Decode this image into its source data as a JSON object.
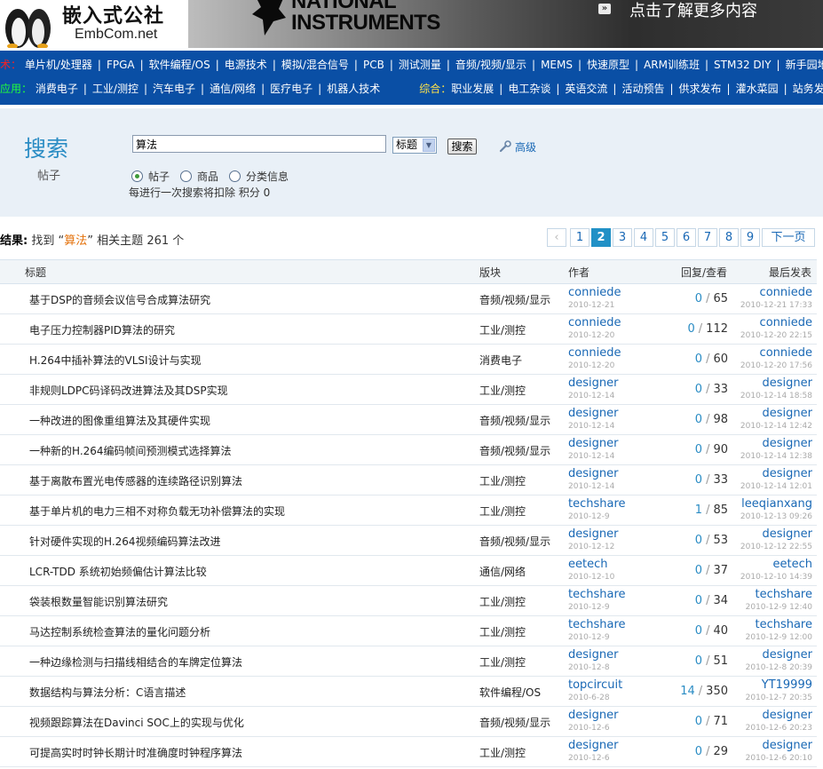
{
  "banner": {
    "logo_cn": "嵌入式公社",
    "logo_en": "EmbCom.net",
    "ad_line1": "NATIONAL",
    "ad_line2": "INSTRUMENTS",
    "ad_arrow": "»",
    "ad_text": "点击了解更多内容"
  },
  "nav": {
    "row1_label": "术：",
    "row1_items": [
      "单片机/处理器",
      "FPGA",
      "软件编程/OS",
      "电源技术",
      "模拟/混合信号",
      "PCB",
      "测试测量",
      "音频/视频/显示",
      "MEMS",
      "快速原型",
      "ARM训练班",
      "STM32 DIY",
      "新手园地"
    ],
    "row2_label": "应用：",
    "row2_items": [
      "消费电子",
      "工业/测控",
      "汽车电子",
      "通信/网络",
      "医疗电子",
      "机器人技术"
    ],
    "row2_label2": "综合：",
    "row2_items2": [
      "职业发展",
      "电工杂谈",
      "英语交流",
      "活动预告",
      "供求发布",
      "灌水菜园",
      "站务发展"
    ]
  },
  "search": {
    "title": "搜索",
    "subtitle": "帖子",
    "query": "算法",
    "scope": "标题",
    "button": "搜索",
    "advanced": "高级",
    "radios": [
      "帖子",
      "商品",
      "分类信息"
    ],
    "selected_radio": 0,
    "notice": "每进行一次搜索将扣除 积分 0"
  },
  "results": {
    "label": "结果:",
    "found": "找到",
    "keyword_open": "“",
    "keyword": "算法",
    "keyword_close": "”",
    "related": "相关主题",
    "count": "261",
    "unit": "个"
  },
  "pager": {
    "prev": "‹",
    "pages": [
      "1",
      "2",
      "3",
      "4",
      "5",
      "6",
      "7",
      "8",
      "9"
    ],
    "current": "2",
    "next": "下一页"
  },
  "table": {
    "headers": {
      "title": "标题",
      "forum": "版块",
      "author": "作者",
      "stats": "回复/查看",
      "last": "最后发表"
    },
    "rows": [
      {
        "title": "基于DSP的音频会议信号合成算法研究",
        "forum": "音频/视频/显示",
        "author": "conniede",
        "adate": "2010-12-21",
        "replies": "0",
        "views": "65",
        "last": "conniede",
        "ldate": "2010-12-21 17:33"
      },
      {
        "title": "电子压力控制器PID算法的研究",
        "forum": "工业/测控",
        "author": "conniede",
        "adate": "2010-12-20",
        "replies": "0",
        "views": "112",
        "last": "conniede",
        "ldate": "2010-12-20 22:15"
      },
      {
        "title": "H.264中插补算法的VLSI设计与实现",
        "forum": "消费电子",
        "author": "conniede",
        "adate": "2010-12-20",
        "replies": "0",
        "views": "60",
        "last": "conniede",
        "ldate": "2010-12-20 17:56"
      },
      {
        "title": "非规则LDPC码译码改进算法及其DSP实现",
        "forum": "工业/测控",
        "author": "designer",
        "adate": "2010-12-14",
        "replies": "0",
        "views": "33",
        "last": "designer",
        "ldate": "2010-12-14 18:58"
      },
      {
        "title": "一种改进的图像重组算法及其硬件实现",
        "forum": "音频/视频/显示",
        "author": "designer",
        "adate": "2010-12-14",
        "replies": "0",
        "views": "98",
        "last": "designer",
        "ldate": "2010-12-14 12:42"
      },
      {
        "title": "一种新的H.264编码帧间预测模式选择算法",
        "forum": "音频/视频/显示",
        "author": "designer",
        "adate": "2010-12-14",
        "replies": "0",
        "views": "90",
        "last": "designer",
        "ldate": "2010-12-14 12:38"
      },
      {
        "title": "基于离散布置光电传感器的连续路径识别算法",
        "forum": "工业/测控",
        "author": "designer",
        "adate": "2010-12-14",
        "replies": "0",
        "views": "33",
        "last": "designer",
        "ldate": "2010-12-14 12:01"
      },
      {
        "title": "基于单片机的电力三相不对称负载无功补偿算法的实现",
        "forum": "工业/测控",
        "author": "techshare",
        "adate": "2010-12-9",
        "replies": "1",
        "views": "85",
        "last": "leeqianxang",
        "ldate": "2010-12-13 09:26"
      },
      {
        "title": "针对硬件实现的H.264视频编码算法改进",
        "forum": "音频/视频/显示",
        "author": "designer",
        "adate": "2010-12-12",
        "replies": "0",
        "views": "53",
        "last": "designer",
        "ldate": "2010-12-12 22:55"
      },
      {
        "title": "LCR-TDD 系统初始频偏估计算法比较",
        "forum": "通信/网络",
        "author": "eetech",
        "adate": "2010-12-10",
        "replies": "0",
        "views": "37",
        "last": "eetech",
        "ldate": "2010-12-10 14:39"
      },
      {
        "title": "袋装根数量智能识别算法研究",
        "forum": "工业/测控",
        "author": "techshare",
        "adate": "2010-12-9",
        "replies": "0",
        "views": "34",
        "last": "techshare",
        "ldate": "2010-12-9 12:40"
      },
      {
        "title": "马达控制系统检查算法的量化问题分析",
        "forum": "工业/测控",
        "author": "techshare",
        "adate": "2010-12-9",
        "replies": "0",
        "views": "40",
        "last": "techshare",
        "ldate": "2010-12-9 12:00"
      },
      {
        "title": "一种边缘检测与扫描线相结合的车牌定位算法",
        "forum": "工业/测控",
        "author": "designer",
        "adate": "2010-12-8",
        "replies": "0",
        "views": "51",
        "last": "designer",
        "ldate": "2010-12-8 20:39"
      },
      {
        "title": "数据结构与算法分析：C语言描述",
        "forum": "软件编程/OS",
        "author": "topcircuit",
        "adate": "2010-6-28",
        "replies": "14",
        "views": "350",
        "last": "YT19999",
        "ldate": "2010-12-7 20:35"
      },
      {
        "title": "视频跟踪算法在Davinci SOC上的实现与优化",
        "forum": "音频/视频/显示",
        "author": "designer",
        "adate": "2010-12-6",
        "replies": "0",
        "views": "71",
        "last": "designer",
        "ldate": "2010-12-6 20:23"
      },
      {
        "title": "可提高实时时钟长期计时准确度时钟程序算法",
        "forum": "工业/测控",
        "author": "designer",
        "adate": "2010-12-6",
        "replies": "0",
        "views": "29",
        "last": "designer",
        "ldate": "2010-12-6 20:10"
      }
    ]
  },
  "colors": {
    "nav_bg": "#0a4fa5",
    "accent": "#2a8cc4",
    "keyword": "#e4720c",
    "link": "#1968b5",
    "panel_bg": "#e9f0f7"
  }
}
